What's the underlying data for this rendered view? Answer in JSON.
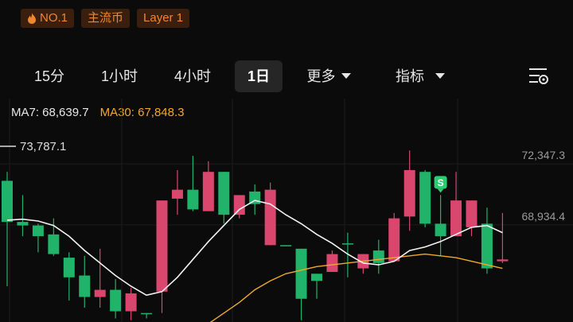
{
  "tags": [
    {
      "label": "NO.1",
      "icon": "flame-icon"
    },
    {
      "label": "主流币"
    },
    {
      "label": "Layer 1"
    }
  ],
  "tabs": [
    {
      "label": "15分",
      "active": false
    },
    {
      "label": "1小时",
      "active": false
    },
    {
      "label": "4小时",
      "active": false
    },
    {
      "label": "1日",
      "active": true
    },
    {
      "label": "更多",
      "active": false,
      "dropdown": true
    },
    {
      "label": "指标",
      "active": false,
      "dropdown": true
    }
  ],
  "settings_icon": "chart-settings-icon",
  "indicators": {
    "ma7": "MA7: 68,639.7",
    "ma30": "MA30: 67,848.3"
  },
  "colors": {
    "up": "#21b36a",
    "down": "#d9466e",
    "ma7": "#f2f2f2",
    "ma30": "#f0a92a",
    "tag_bg": "#3a1f0f",
    "tag_text": "#f0862f",
    "signal": "#2ecc71"
  },
  "chart_data": {
    "type": "candlestick",
    "ylim": [
      63500,
      76000
    ],
    "y_ticks": [
      "72,347.3",
      "68,934.4"
    ],
    "y_tick_values": [
      72347.3,
      68934.4
    ],
    "max_label": "73,787.1",
    "max_value": 73787.1,
    "signal_label": "S",
    "signal_index": 28,
    "candles": [
      [
        69100,
        71400,
        65500,
        71900
      ],
      [
        68900,
        69100,
        68300,
        70600
      ],
      [
        68300,
        68900,
        67400,
        69000
      ],
      [
        67300,
        68400,
        67200,
        69300
      ],
      [
        66000,
        67100,
        64700,
        67400
      ],
      [
        64900,
        66100,
        64300,
        67200
      ],
      [
        65300,
        64900,
        64300,
        67600
      ],
      [
        64100,
        65300,
        63700,
        65900
      ],
      [
        65100,
        64100,
        63600,
        65400
      ],
      [
        64000,
        64000,
        63700,
        64000
      ],
      [
        70300,
        65200,
        64000,
        70300
      ],
      [
        70900,
        70400,
        69500,
        72000
      ],
      [
        69800,
        70900,
        69700,
        72800
      ],
      [
        71900,
        69700,
        69700,
        72500
      ],
      [
        69500,
        71900,
        69000,
        71900
      ],
      [
        70600,
        69500,
        69300,
        70600
      ],
      [
        70100,
        70800,
        69500,
        71200
      ],
      [
        70900,
        67800,
        67800,
        71300
      ],
      [
        67800,
        67800,
        67800,
        67800
      ],
      [
        64800,
        67600,
        63600,
        67600
      ],
      [
        65800,
        66200,
        64800,
        66200
      ],
      [
        67300,
        66300,
        66300,
        67500
      ],
      [
        67900,
        67900,
        66000,
        68500
      ],
      [
        67300,
        66500,
        66200,
        67300
      ],
      [
        66800,
        67500,
        66200,
        68100
      ],
      [
        69300,
        66900,
        66900,
        69600
      ],
      [
        72000,
        69400,
        68600,
        73100
      ],
      [
        69000,
        71900,
        68800,
        72000
      ],
      [
        68300,
        69000,
        67200,
        70600
      ],
      [
        70300,
        68300,
        68300,
        71900
      ],
      [
        70300,
        68800,
        68300,
        70300
      ],
      [
        66500,
        69000,
        66200,
        69900
      ],
      [
        67000,
        66900,
        66800,
        69600
      ]
    ],
    "ma7": [
      69200,
      69250,
      69150,
      68900,
      68300,
      67500,
      66800,
      66100,
      65500,
      65000,
      65200,
      66000,
      67000,
      68000,
      68900,
      69800,
      70300,
      70100,
      69500,
      69000,
      68400,
      67900,
      67300,
      66800,
      66700,
      66900,
      67500,
      67700,
      68000,
      68400,
      68800,
      68900,
      68500
    ],
    "ma30": [
      null,
      null,
      null,
      null,
      null,
      null,
      null,
      null,
      null,
      null,
      null,
      null,
      62900,
      63400,
      64000,
      64600,
      65300,
      65800,
      66200,
      66400,
      66600,
      66700,
      66800,
      66900,
      67000,
      67100,
      67200,
      67300,
      67200,
      67100,
      66900,
      66700,
      66500
    ]
  }
}
